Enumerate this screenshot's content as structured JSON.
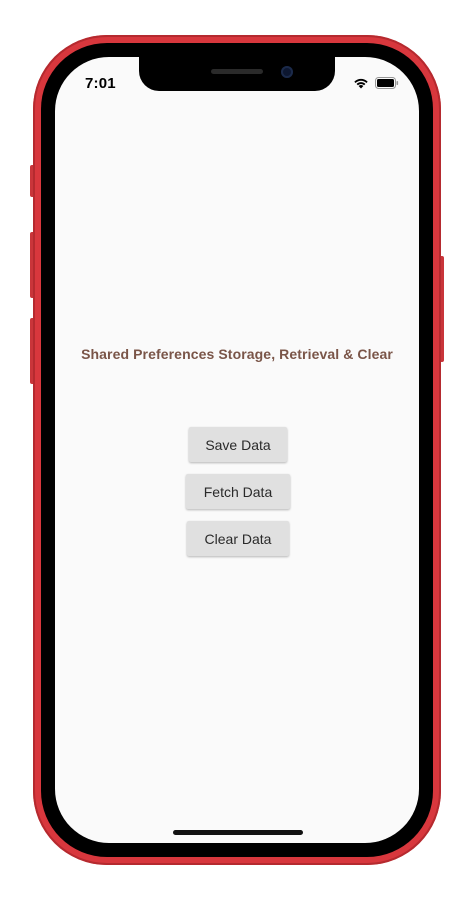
{
  "status_bar": {
    "time": "7:01",
    "icons": [
      "signal-icon",
      "wifi-icon",
      "battery-icon"
    ]
  },
  "main": {
    "title": "Shared Preferences Storage, Retrieval & Clear",
    "buttons": {
      "save_label": "Save Data",
      "fetch_label": "Fetch Data",
      "clear_label": "Clear Data"
    }
  },
  "colors": {
    "phone_frame": "#d8373d",
    "screen_background": "#fafafa",
    "title_text": "#7a5548",
    "button_background": "#e0e0e0"
  }
}
